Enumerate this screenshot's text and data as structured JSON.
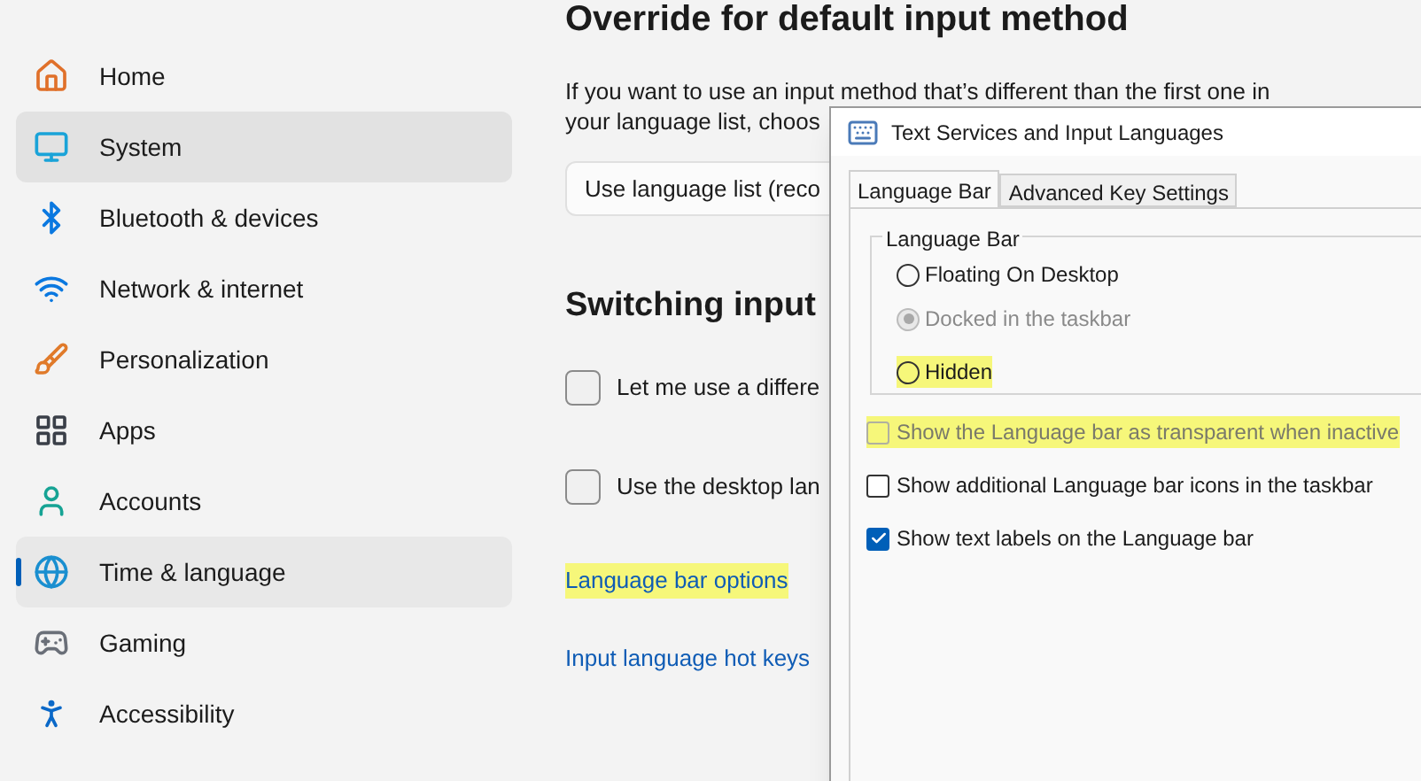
{
  "sidebar": {
    "items": [
      {
        "label": "Home",
        "selected": false,
        "hovered": false
      },
      {
        "label": "System",
        "selected": false,
        "hovered": true
      },
      {
        "label": "Bluetooth & devices",
        "selected": false,
        "hovered": false
      },
      {
        "label": "Network & internet",
        "selected": false,
        "hovered": false
      },
      {
        "label": "Personalization",
        "selected": false,
        "hovered": false
      },
      {
        "label": "Apps",
        "selected": false,
        "hovered": false
      },
      {
        "label": "Accounts",
        "selected": false,
        "hovered": false
      },
      {
        "label": "Time & language",
        "selected": true,
        "hovered": false
      },
      {
        "label": "Gaming",
        "selected": false,
        "hovered": false
      },
      {
        "label": "Accessibility",
        "selected": false,
        "hovered": false
      }
    ]
  },
  "main": {
    "heading": "Override for default input method",
    "description": [
      "If you want to use an input method that’s different than the first one in",
      "your language list, choos"
    ],
    "dropdown": {
      "value": "Use language list (reco"
    },
    "heading_2": "Switching input",
    "checkboxes": [
      {
        "label": "Let me use a differe",
        "checked": false
      },
      {
        "label": "Use the desktop lan",
        "checked": false
      }
    ],
    "links": [
      {
        "label": "Language bar options",
        "highlighted": true
      },
      {
        "label": "Input language hot keys",
        "highlighted": false
      }
    ]
  },
  "dialog": {
    "title": "Text Services and Input Languages",
    "tabs": [
      {
        "label": "Language Bar",
        "selected": true
      },
      {
        "label": "Advanced Key Settings",
        "selected": false
      }
    ],
    "group": {
      "title": "Language Bar",
      "radios": [
        {
          "label": "Floating On Desktop",
          "selected": false,
          "disabled": false,
          "highlighted": false
        },
        {
          "label": "Docked in the taskbar",
          "selected": true,
          "disabled": true,
          "highlighted": false
        },
        {
          "label": "Hidden",
          "selected": false,
          "disabled": false,
          "highlighted": true
        }
      ]
    },
    "checkboxes": [
      {
        "label": "Show the Language bar as transparent when inactive",
        "checked": false,
        "disabled": true,
        "highlighted": true
      },
      {
        "label": "Show additional Language bar icons in the taskbar",
        "checked": false,
        "disabled": false,
        "highlighted": false
      },
      {
        "label": "Show text labels on the Language bar",
        "checked": true,
        "disabled": false,
        "highlighted": false
      }
    ]
  }
}
